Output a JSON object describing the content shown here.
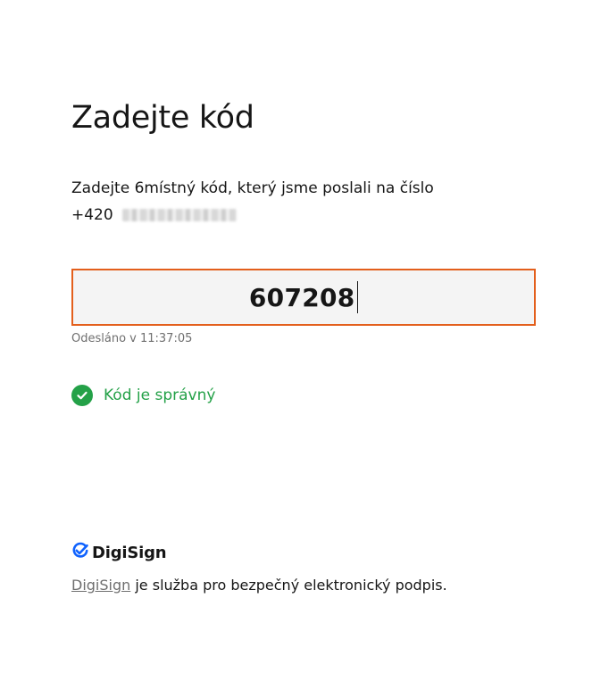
{
  "heading": "Zadejte kód",
  "instructions": {
    "line1": "Zadejte 6místný kód, který jsme poslali na číslo",
    "phone_prefix": "+420"
  },
  "code_input": {
    "value": "607208"
  },
  "sent_time": "Odesláno v 11:37:05",
  "status": {
    "text": "Kód je správný",
    "icon": "check-circle-icon",
    "color": "#24a148"
  },
  "brand": {
    "name": "DigiSign",
    "icon": "digisign-check-icon",
    "color": "#0f62fe"
  },
  "footer": {
    "link_text": "DigiSign",
    "text": " je služba pro bezpečný elektronický podpis."
  },
  "colors": {
    "input_border": "#e35f1c",
    "input_background": "#f4f4f4"
  }
}
